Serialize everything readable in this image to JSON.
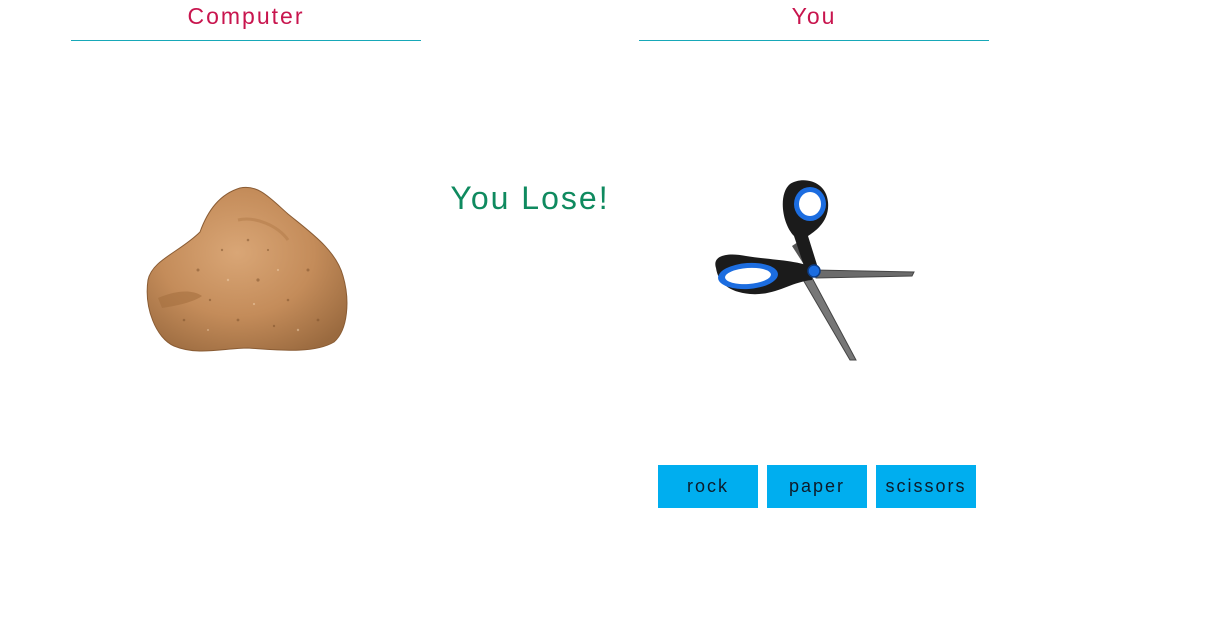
{
  "computer": {
    "label": "Computer",
    "choice": "rock",
    "choice_icon": "rock-icon"
  },
  "player": {
    "label": "You",
    "choice": "scissors",
    "choice_icon": "scissors-icon"
  },
  "result": {
    "text": "You Lose!"
  },
  "buttons": [
    {
      "label": "rock"
    },
    {
      "label": "paper"
    },
    {
      "label": "scissors"
    }
  ],
  "colors": {
    "heading": "#c8154e",
    "divider": "#17a8b8",
    "result": "#0f8a5f",
    "button_bg": "#00aeef",
    "button_text": "#0d1b2a",
    "scissors_handle": "#1c6de0",
    "rock": "#c48c5a"
  }
}
